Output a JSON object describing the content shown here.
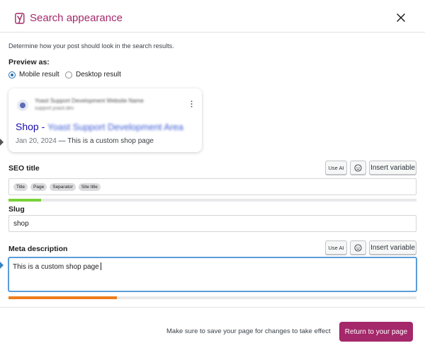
{
  "modal": {
    "title": "Search appearance",
    "description": "Determine how your post should look in the search results.",
    "close_icon": "close-icon"
  },
  "preview": {
    "label": "Preview as:",
    "options": [
      {
        "label": "Mobile result",
        "selected": true
      },
      {
        "label": "Desktop result",
        "selected": false
      }
    ]
  },
  "serp": {
    "site_name": "Yoast Support Development Website Name",
    "site_url": "support.yoast.dev",
    "title_prefix": "Shop - ",
    "title_blurred": "Yoast Support Development Area",
    "date": "Jan 20, 2024",
    "separator": "—",
    "snippet": "This is a custom shop page"
  },
  "seo_title": {
    "label": "SEO title",
    "use_ai": "Use AI",
    "insert_variable": "Insert variable",
    "tags": [
      "Title",
      "Page",
      "Separator",
      "Site title"
    ],
    "progress_fraction": 0.08,
    "progress_color": "#7ad03a"
  },
  "slug": {
    "label": "Slug",
    "value": "shop"
  },
  "meta": {
    "label": "Meta description",
    "use_ai": "Use AI",
    "insert_variable": "Insert variable",
    "value": "This is a custom shop page",
    "progress_fraction": 0.265,
    "progress_color": "#ee7c1b"
  },
  "footer": {
    "note": "Make sure to save your page for changes to take effect",
    "return_button": "Return to your page"
  },
  "colors": {
    "brand": "#a4286a",
    "link": "#1a0dab",
    "focus": "#5b9dd9"
  }
}
